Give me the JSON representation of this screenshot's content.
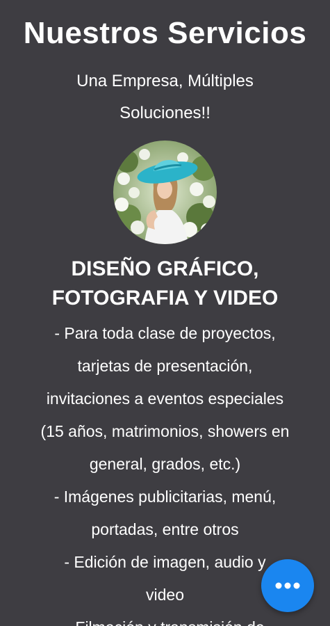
{
  "page": {
    "title": "Nuestros Servicios",
    "subtitle_line1": "Una Empresa, Múltiples",
    "subtitle_line2": "Soluciones!!"
  },
  "image": {
    "icon": "woman-in-flowers-photo"
  },
  "section": {
    "title_line1": "DISEÑO GRÁFICO,",
    "title_line2": "FOTOGRAFIA Y VIDEO",
    "lines": [
      "-    Para toda clase de proyectos,",
      "tarjetas de presentación,",
      "invitaciones a eventos especiales",
      "(15 años, matrimonios, showers en",
      "general, grados, etc.)",
      "-    Imágenes publicitarias, menú,",
      "portadas, entre otros",
      "-    Edición de imagen, audio y",
      "video",
      "-    Filmación y transmisión de"
    ]
  },
  "fab": {
    "icon": "more-horizontal-icon",
    "color": "#1a86f0"
  },
  "colors": {
    "background": "#3e3d42",
    "text": "#ffffff"
  }
}
